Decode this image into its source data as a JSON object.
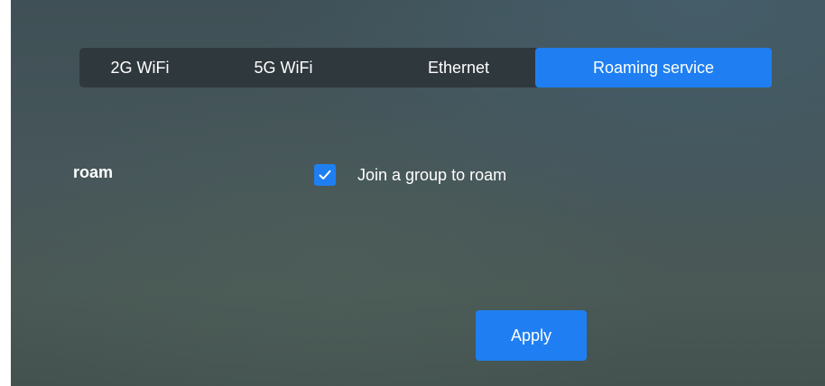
{
  "tabs": [
    {
      "label": "2G WiFi",
      "active": false
    },
    {
      "label": "5G WiFi",
      "active": false
    },
    {
      "label": "Ethernet",
      "active": false
    },
    {
      "label": "Roaming service",
      "active": true
    }
  ],
  "form": {
    "roam_label": "roam",
    "join_group": {
      "label": "Join a group to roam",
      "checked": true,
      "icon": "checkmark-icon"
    }
  },
  "actions": {
    "apply_label": "Apply"
  },
  "colors": {
    "accent": "#1f7ff2",
    "tabbar_bg": "#2f383d",
    "text": "#ffffff"
  }
}
